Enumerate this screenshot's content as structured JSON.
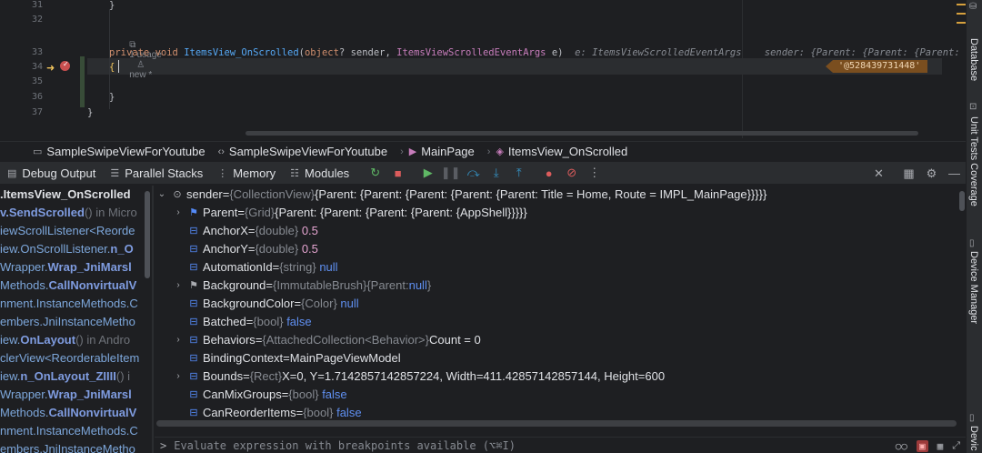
{
  "editor": {
    "line_numbers": [
      "31",
      "32",
      "33",
      "34",
      "35",
      "36",
      "37"
    ],
    "usage_hint": "1 usage",
    "new_hint": "new *",
    "line31": "}",
    "line33": {
      "kw1": "private",
      "kw2": "void",
      "fn": "ItemsView_OnScrolled",
      "p1": "(",
      "kw3": "object",
      "p2": "? sender, ",
      "ty": "ItemsViewScrolledEventArgs",
      "p3": " e)",
      "hint1": "e: ItemsViewScrolledEventArgs",
      "hint2": "sender: {Parent: {Parent: {Parent: {Parent: {Pare"
    },
    "line34": "{",
    "line36": "}",
    "line37": "}",
    "inline_value": "'@528439731448'"
  },
  "breadcrumb": {
    "project": "SampleSwipeViewForYoutube",
    "namespace": "SampleSwipeViewForYoutube",
    "class": "MainPage",
    "method": "ItemsView_OnScrolled"
  },
  "toolbar": {
    "debug_output": "Debug Output",
    "parallel_stacks": "Parallel Stacks",
    "memory": "Memory",
    "modules": "Modules"
  },
  "frames": [
    {
      "bold": ".ItemsView_OnScrolled",
      "pre": "",
      "post": "",
      "selected": true
    },
    {
      "pre": "",
      "bold": "v.SendScrolled",
      "post": "() in Micro"
    },
    {
      "pre": "iewScrollListener<Reorde",
      "bold": "",
      "post": ""
    },
    {
      "pre": "iew.OnScrollListener.",
      "bold": "n_O",
      "post": ""
    },
    {
      "pre": "Wrapper.",
      "bold": "Wrap_JniMarsl",
      "post": ""
    },
    {
      "pre": "Methods.",
      "bold": "CallNonvirtualV",
      "post": ""
    },
    {
      "pre": "nment.InstanceMethods.C",
      "bold": "",
      "post": ""
    },
    {
      "pre": "embers.JniInstanceMetho",
      "bold": "",
      "post": ""
    },
    {
      "pre": "iew.",
      "bold": "OnLayout",
      "post": "() in Andro"
    },
    {
      "pre": "clerView<ReorderableItem",
      "bold": "",
      "post": ""
    },
    {
      "pre": "iew.",
      "bold": "n_OnLayout_ZIIII",
      "post": "() i"
    },
    {
      "pre": "Wrapper.",
      "bold": "Wrap_JniMarsl",
      "post": ""
    },
    {
      "pre": "Methods.",
      "bold": "CallNonvirtualV",
      "post": ""
    },
    {
      "pre": "nment.InstanceMethods.C",
      "bold": "",
      "post": ""
    },
    {
      "pre": "embers.JniInstanceMetho",
      "bold": "",
      "post": ""
    }
  ],
  "variables": {
    "sender": {
      "name": "sender",
      "eq": " = ",
      "type": "{CollectionView}",
      "value": " {Parent: {Parent: {Parent: {Parent: {Parent: Title = Home, Route = IMPL_MainPage}}}}}"
    },
    "items": [
      {
        "name": "Parent",
        "type": "{Grid}",
        "value": " {Parent: {Parent: {Parent: {Parent: {AppShell}}}}}",
        "expandable": true,
        "icon": "flag-icon"
      },
      {
        "name": "AnchorX",
        "type": "{double}",
        "value": "0.5",
        "vclass": "num",
        "icon": "property-icon"
      },
      {
        "name": "AnchorY",
        "type": "{double}",
        "value": "0.5",
        "vclass": "num",
        "icon": "property-icon"
      },
      {
        "name": "AutomationId",
        "type": "{string}",
        "value": "null",
        "vclass": "kwv",
        "icon": "property-icon"
      },
      {
        "name": "Background",
        "type": "{ImmutableBrush}",
        "value_pre": " {Parent: ",
        "value": "null",
        "value_post": "}",
        "vclass": "kwv",
        "expandable": true,
        "icon": "flag-icon",
        "muted": true
      },
      {
        "name": "BackgroundColor",
        "type": "{Color}",
        "value": "null",
        "vclass": "kwv",
        "icon": "property-icon"
      },
      {
        "name": "Batched",
        "type": "{bool}",
        "value": "false",
        "vclass": "kwv",
        "icon": "property-icon"
      },
      {
        "name": "Behaviors",
        "type": "{AttachedCollection<Behavior>}",
        "value": " Count = 0",
        "expandable": true,
        "icon": "property-icon"
      },
      {
        "name": "BindingContext",
        "type": "",
        "value": "MainPageViewModel",
        "icon": "property-icon"
      },
      {
        "name": "Bounds",
        "type": "{Rect}",
        "value": " X=0, Y=1.7142857142857224, Width=411.42857142857144, Height=600",
        "expandable": true,
        "icon": "property-icon"
      },
      {
        "name": "CanMixGroups",
        "type": "{bool}",
        "value": "false",
        "vclass": "kwv",
        "icon": "property-icon"
      },
      {
        "name": "CanReorderItems",
        "type": "{bool}",
        "value": "false",
        "vclass": "kwv",
        "icon": "property-icon"
      }
    ]
  },
  "eval": {
    "prompt": ">",
    "placeholder": "Evaluate expression with breakpoints available (⌥⌘I)"
  },
  "right_strip": {
    "database": "Database",
    "unit_tests": "Unit Tests Coverage",
    "device_manager": "Device Manager",
    "device": "Devic"
  },
  "colors": {
    "accent_breakpoint": "#c94f4f",
    "inline_value_bg": "#7a4e1f",
    "run_green": "#5fb865",
    "stop_red": "#db5c5c"
  }
}
